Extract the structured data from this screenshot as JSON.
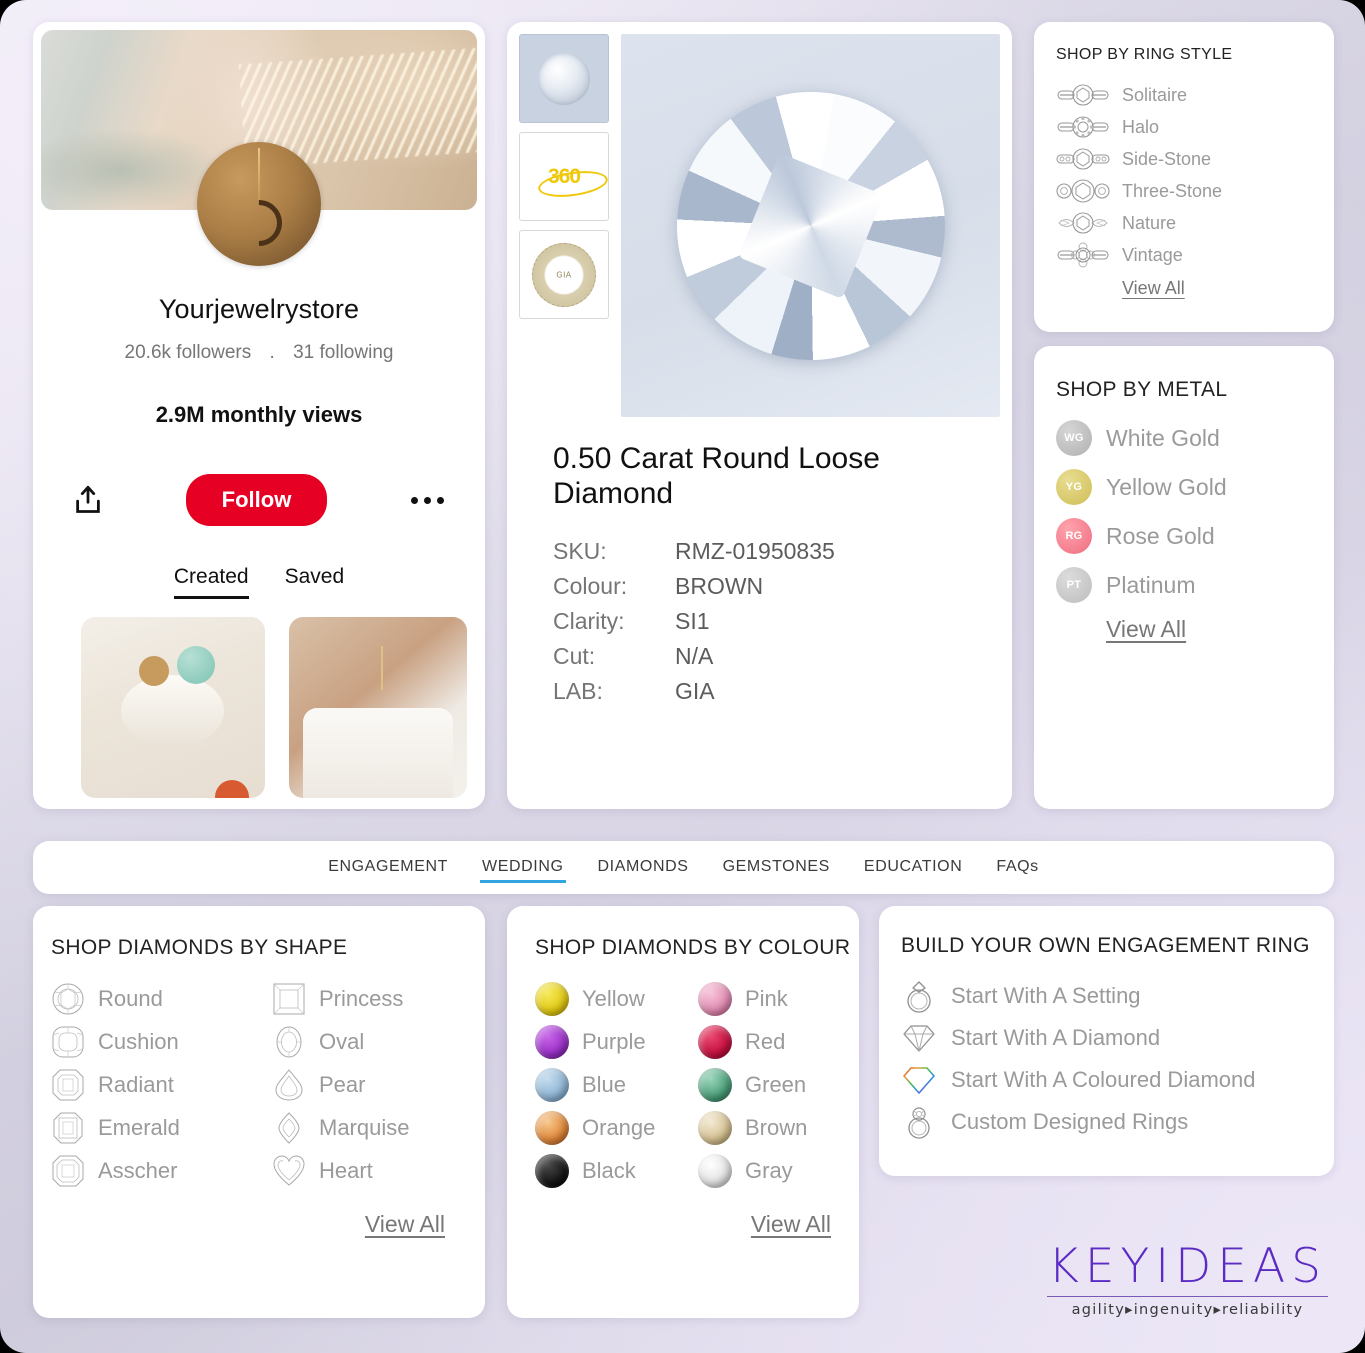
{
  "profile": {
    "name": "Yourjewelrystore",
    "followers": "20.6k followers",
    "separator": ".",
    "following": "31 following",
    "monthly_views": "2.9M monthly views",
    "follow_label": "Follow",
    "share_icon": "share-icon",
    "more_icon": "more-options-icon",
    "tabs": [
      {
        "label": "Created",
        "active": true
      },
      {
        "label": "Saved",
        "active": false
      }
    ]
  },
  "product": {
    "thumbnails": [
      {
        "name": "diamond-photo-thumbnail",
        "selected": true
      },
      {
        "name": "360-view-thumbnail",
        "label": "360",
        "selected": false
      },
      {
        "name": "gia-certificate-thumbnail",
        "label": "GIA",
        "selected": false
      }
    ],
    "title": "0.50 Carat Round Loose Diamond",
    "specs": [
      {
        "key": "SKU:",
        "value": "RMZ-01950835"
      },
      {
        "key": "Colour:",
        "value": "BROWN"
      },
      {
        "key": "Clarity:",
        "value": "SI1"
      },
      {
        "key": "Cut:",
        "value": "N/A"
      },
      {
        "key": "LAB:",
        "value": "GIA"
      }
    ]
  },
  "ring_style": {
    "heading": "SHOP BY RING STYLE",
    "items": [
      {
        "label": "Solitaire"
      },
      {
        "label": "Halo"
      },
      {
        "label": "Side-Stone"
      },
      {
        "label": "Three-Stone"
      },
      {
        "label": "Nature"
      },
      {
        "label": "Vintage"
      }
    ],
    "view_all": "View All"
  },
  "metal": {
    "heading": "SHOP BY METAL",
    "items": [
      {
        "label": "White Gold",
        "code": "WG",
        "color": "#b9b9b9"
      },
      {
        "label": "Yellow Gold",
        "code": "YG",
        "color": "#d9c96a"
      },
      {
        "label": "Rose Gold",
        "code": "RG",
        "color": "#f2808f"
      },
      {
        "label": "Platinum",
        "code": "PT",
        "color": "#c4c4c4"
      }
    ],
    "view_all": "View All"
  },
  "nav": {
    "tabs": [
      {
        "label": "ENGAGEMENT",
        "active": false
      },
      {
        "label": "WEDDING",
        "active": true
      },
      {
        "label": "DIAMONDS",
        "active": false
      },
      {
        "label": "GEMSTONES",
        "active": false
      },
      {
        "label": "EDUCATION",
        "active": false
      },
      {
        "label": "FAQs",
        "active": false
      }
    ],
    "active_color": "#30a5e0"
  },
  "shape": {
    "heading": "SHOP DIAMONDS BY SHAPE",
    "left": [
      {
        "label": "Round"
      },
      {
        "label": "Cushion"
      },
      {
        "label": "Radiant"
      },
      {
        "label": "Emerald"
      },
      {
        "label": "Asscher"
      }
    ],
    "right": [
      {
        "label": "Princess"
      },
      {
        "label": "Oval"
      },
      {
        "label": "Pear"
      },
      {
        "label": "Marquise"
      },
      {
        "label": "Heart"
      }
    ],
    "view_all": "View All"
  },
  "colour": {
    "heading": "SHOP DIAMONDS BY COLOUR",
    "left": [
      {
        "label": "Yellow",
        "color": "#e8d41a"
      },
      {
        "label": "Purple",
        "color": "#9b30c8"
      },
      {
        "label": "Blue",
        "color": "#8fb4d4"
      },
      {
        "label": "Orange",
        "color": "#e08a3c"
      },
      {
        "label": "Black",
        "color": "#1a1a1a"
      }
    ],
    "right": [
      {
        "label": "Pink",
        "color": "#e08ab0"
      },
      {
        "label": "Red",
        "color": "#c81040"
      },
      {
        "label": "Green",
        "color": "#4a9e78"
      },
      {
        "label": "Brown",
        "color": "#d4c090"
      },
      {
        "label": "Gray",
        "color": "#e2e2e2"
      }
    ],
    "view_all": "View All"
  },
  "build": {
    "heading": "BUILD YOUR OWN ENGAGEMENT RING",
    "items": [
      {
        "label": "Start With A Setting",
        "icon": "ring-setting-icon"
      },
      {
        "label": "Start With A Diamond",
        "icon": "diamond-icon"
      },
      {
        "label": "Start With A Coloured Diamond",
        "icon": "coloured-diamond-icon"
      },
      {
        "label": "Custom Designed Rings",
        "icon": "custom-ring-icon"
      }
    ]
  },
  "logo": {
    "word": "KEYIDEAS",
    "tagline": "agility▸ingenuity▸reliability",
    "color": "#5b2bc4"
  }
}
